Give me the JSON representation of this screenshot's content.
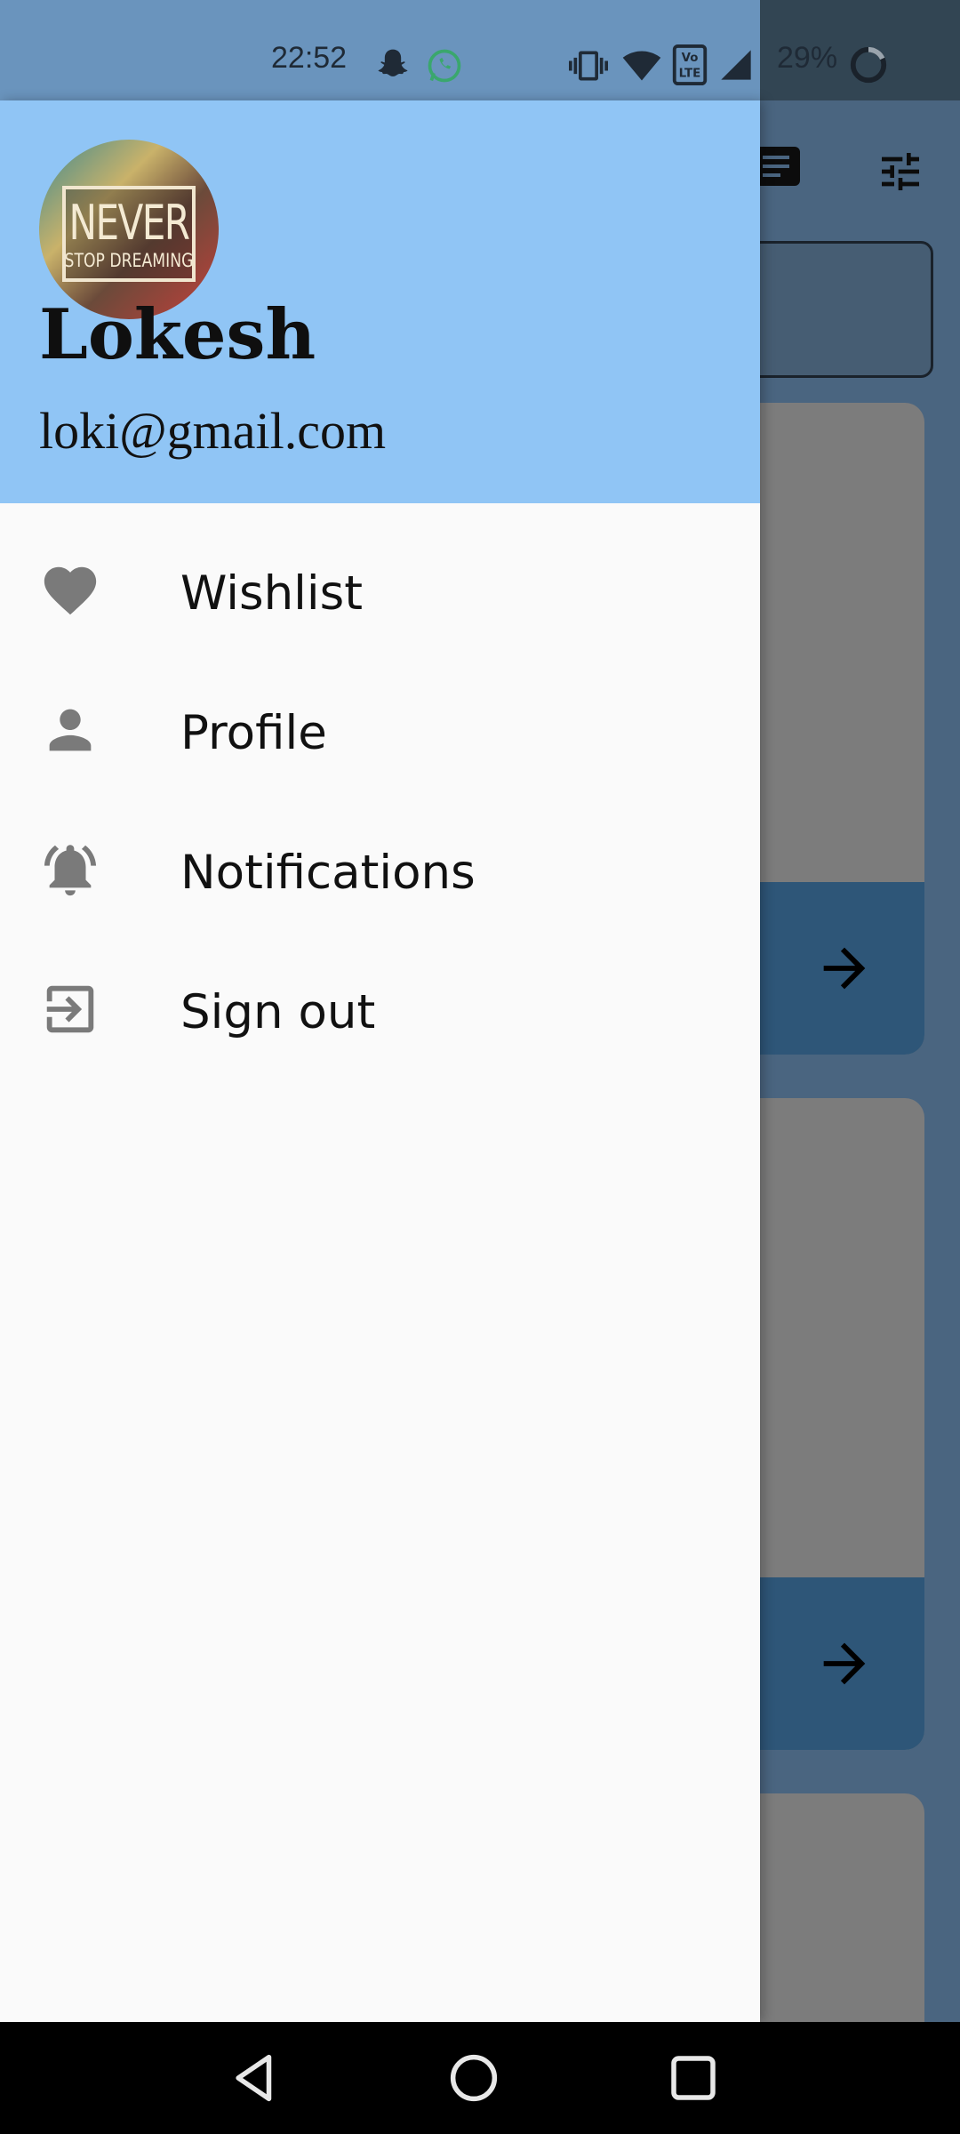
{
  "status_bar": {
    "time": "22:52",
    "battery": "29%",
    "icons": [
      "snapchat-icon",
      "whatsapp-icon",
      "vibrate-icon",
      "wifi-icon",
      "volte-icon",
      "signal-icon",
      "battery-icon"
    ]
  },
  "drawer": {
    "user_name": "Lokesh",
    "user_email": "loki@gmail.com",
    "avatar_text_top": "NEVER",
    "avatar_text_bottom": "STOP DREAMING",
    "menu": [
      {
        "label": "Wishlist",
        "icon": "heart-icon"
      },
      {
        "label": "Profile",
        "icon": "person-icon"
      },
      {
        "label": "Notifications",
        "icon": "bell-icon"
      },
      {
        "label": "Sign out",
        "icon": "sign-out-icon"
      }
    ]
  },
  "colors": {
    "drawer_header": "#90c5f5",
    "drawer_body": "#fafafa",
    "scrim_background": "#4a6580",
    "card_footer": "#2e5678"
  },
  "nav_bar": {
    "buttons": [
      "back-icon",
      "home-icon",
      "recents-icon"
    ]
  }
}
